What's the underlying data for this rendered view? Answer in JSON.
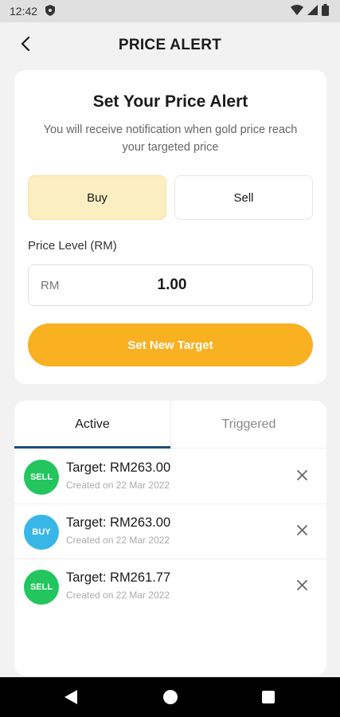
{
  "status_bar": {
    "time": "12:42",
    "icons": [
      "shield-icon",
      "wifi-icon",
      "signal-icon",
      "battery-icon"
    ]
  },
  "header": {
    "title": "PRICE ALERT",
    "back_icon": "chevron-left-icon"
  },
  "alert_form": {
    "title": "Set Your Price Alert",
    "description": "You will receive notification when gold price reach your targeted price",
    "buy_label": "Buy",
    "sell_label": "Sell",
    "selected": "Buy",
    "price_label": "Price Level (RM)",
    "currency_prefix": "RM",
    "price_value": "1.00",
    "submit_label": "Set New Target"
  },
  "tabs": {
    "active_label": "Active",
    "triggered_label": "Triggered",
    "selected": "Active"
  },
  "alerts": [
    {
      "type": "SELL",
      "target": "Target: RM263.00",
      "created": "Created on 22 Mar 2022"
    },
    {
      "type": "BUY",
      "target": "Target: RM263.00",
      "created": "Created on 22 Mar 2022"
    },
    {
      "type": "SELL",
      "target": "Target: RM261.77",
      "created": "Created on 22 Mar 2022"
    }
  ],
  "colors": {
    "accent": "#f9b021",
    "buy_selected_bg": "#fbeec0",
    "sell_badge": "#22c55e",
    "buy_badge": "#38b6e8",
    "tab_underline": "#1f4e79"
  }
}
